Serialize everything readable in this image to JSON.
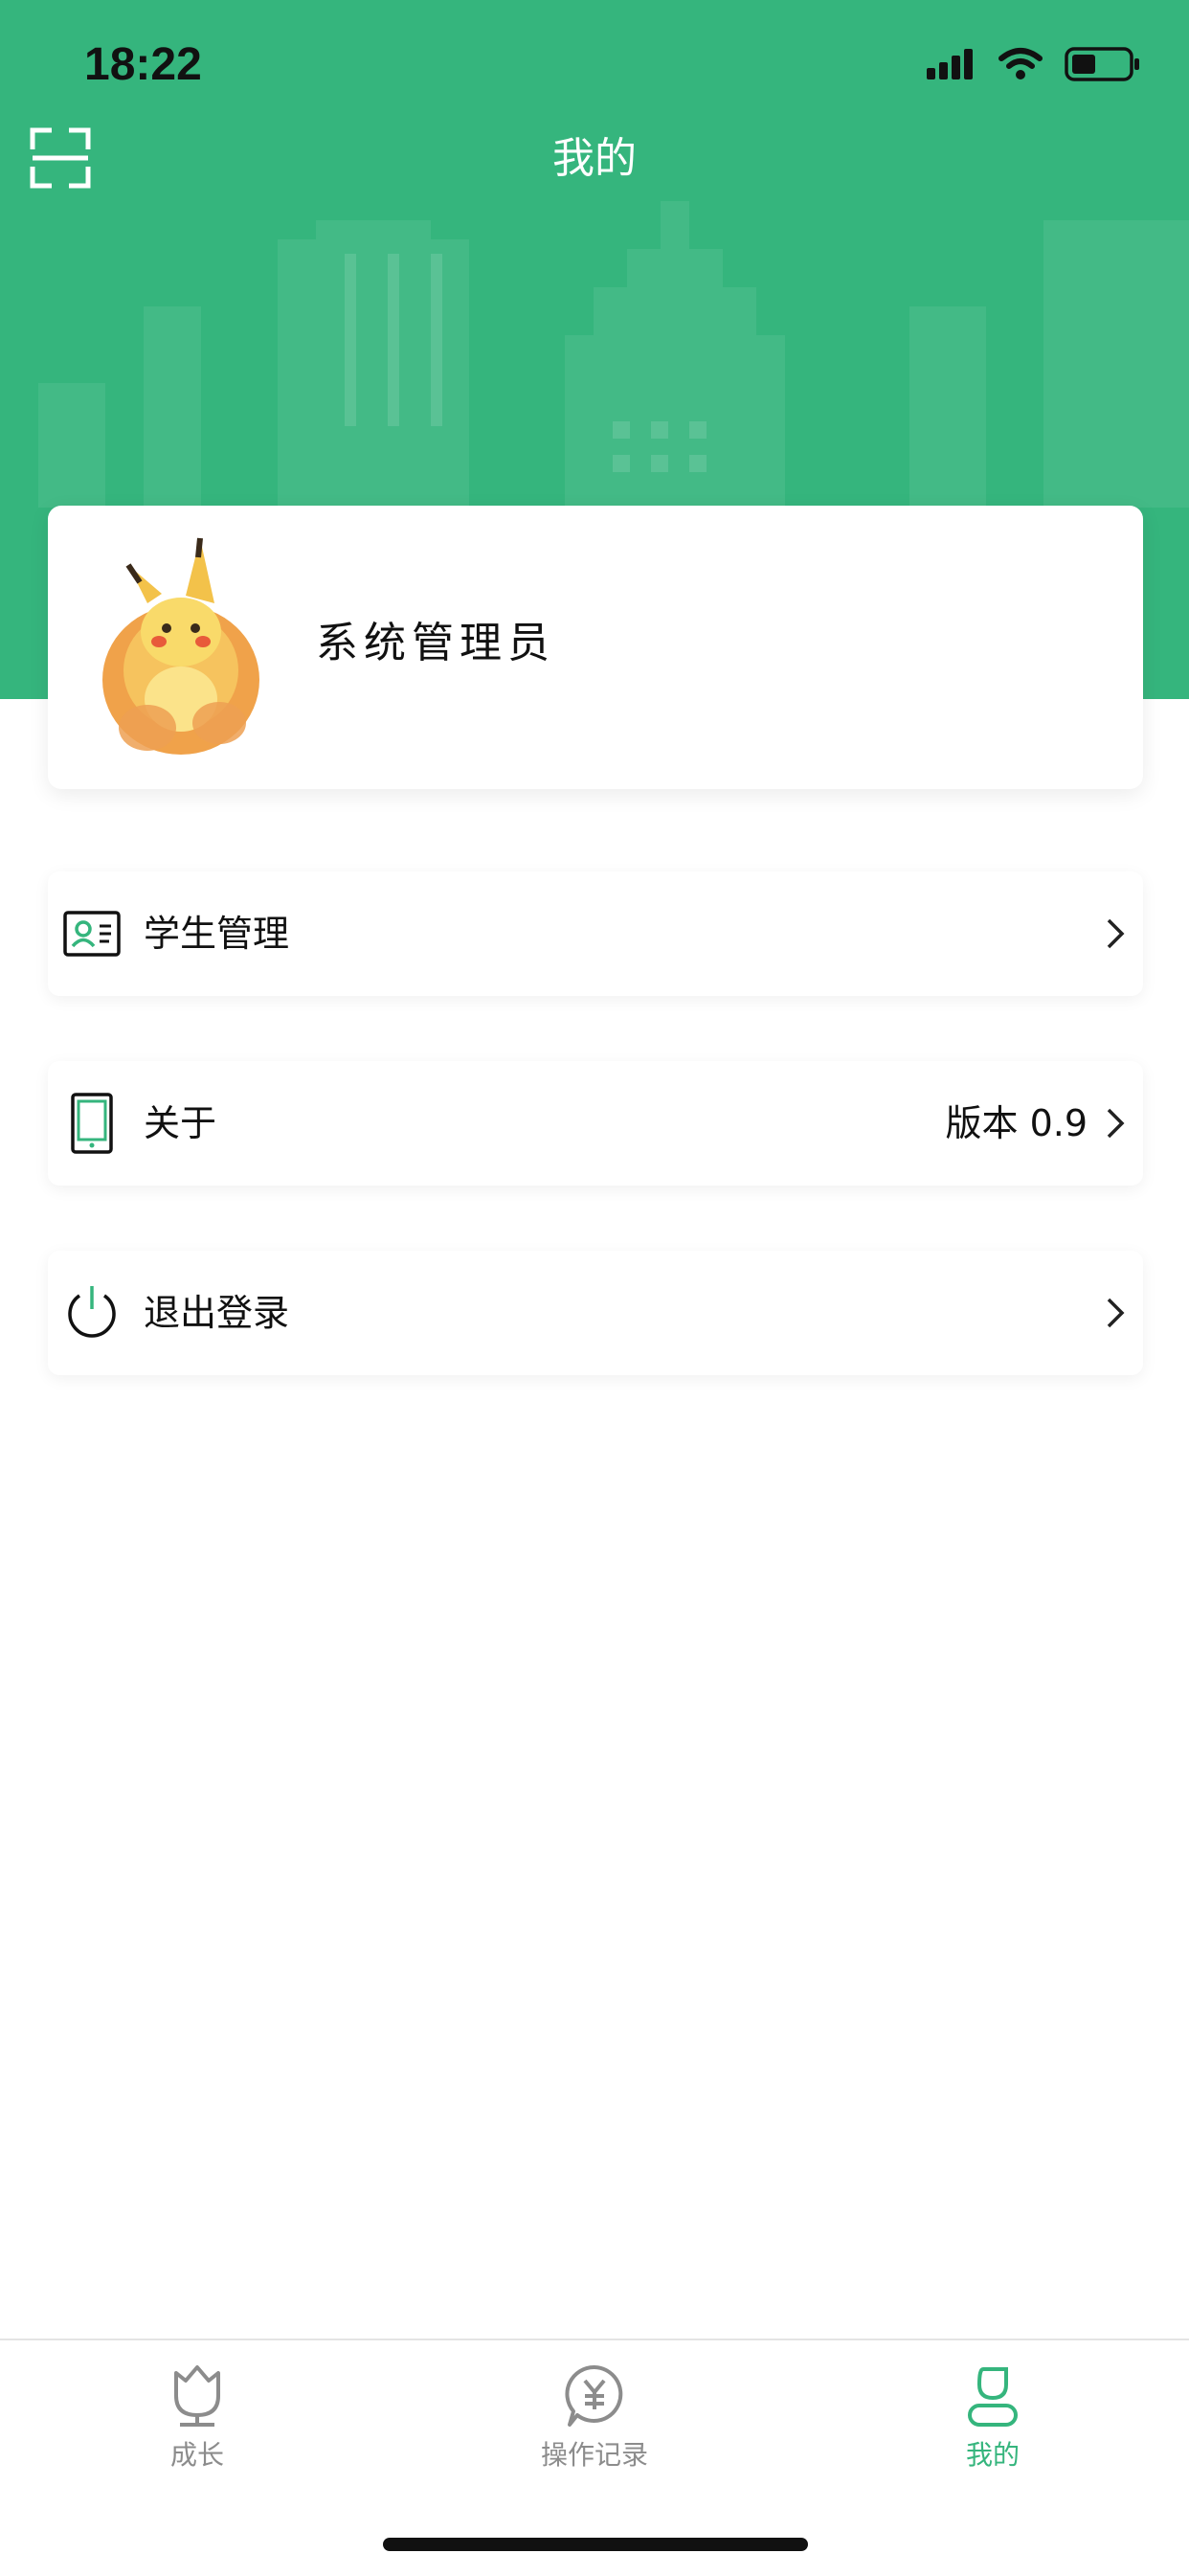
{
  "status_bar": {
    "time": "18:22"
  },
  "header": {
    "title": "我的",
    "scan_icon": "scan-icon"
  },
  "profile": {
    "name": "系统管理员",
    "avatar_icon": "pikachu-avatar"
  },
  "menu": {
    "items": [
      {
        "label": "学生管理",
        "value": "",
        "icon": "student-card-icon"
      },
      {
        "label": "关于",
        "value": "版本 0.9",
        "icon": "phone-icon"
      },
      {
        "label": "退出登录",
        "value": "",
        "icon": "power-icon"
      }
    ]
  },
  "tabbar": {
    "tabs": [
      {
        "label": "成长",
        "icon": "tulip-icon",
        "active": false
      },
      {
        "label": "操作记录",
        "icon": "yen-bubble-icon",
        "active": false
      },
      {
        "label": "我的",
        "icon": "person-icon",
        "active": true
      }
    ]
  },
  "colors": {
    "brand_green": "#35b57d",
    "text_dark": "#111111",
    "tab_inactive": "#8c8c8c"
  }
}
